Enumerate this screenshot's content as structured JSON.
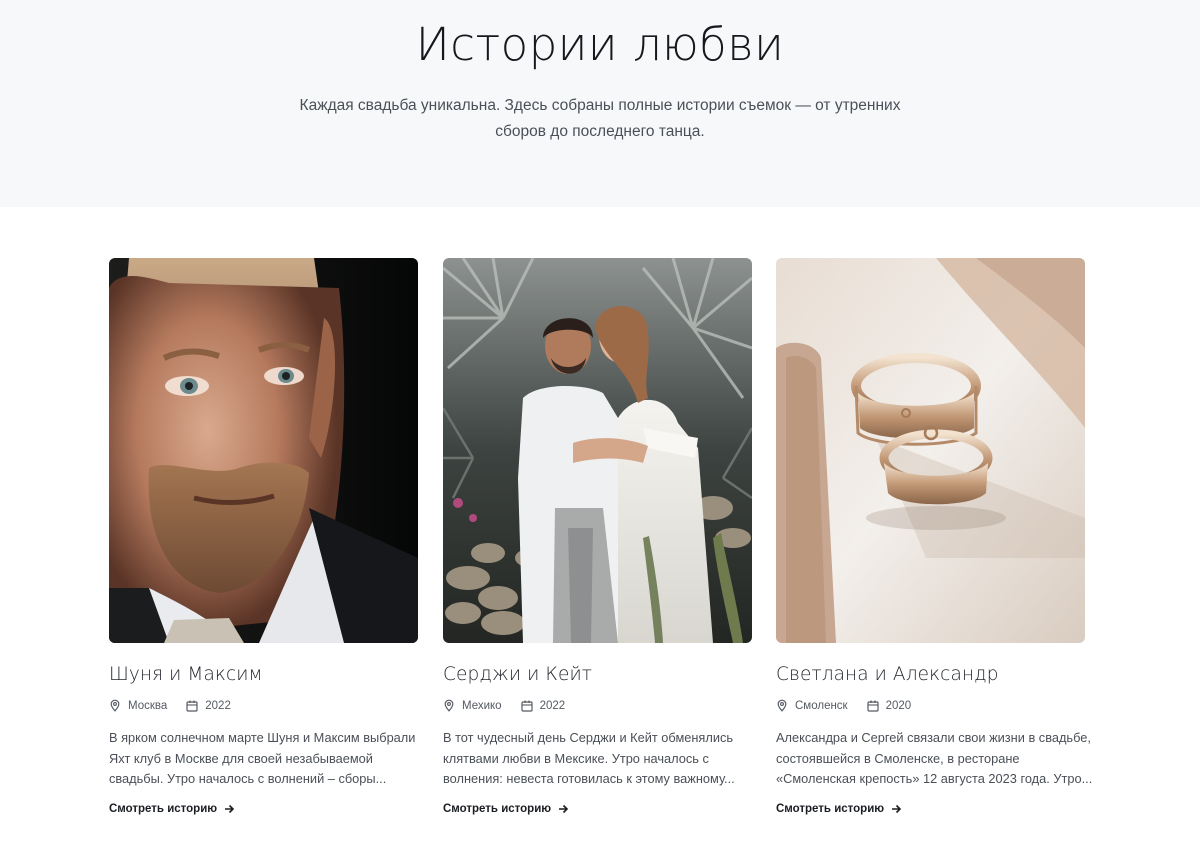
{
  "hero": {
    "title": "Истории любви",
    "subtitle": "Каждая свадьба уникальна. Здесь собраны полные истории съемок — от утренних сборов до последнего танца."
  },
  "stories": [
    {
      "title": "Шуня и Максим",
      "location": "Москва",
      "year": "2022",
      "description": "В ярком солнечном марте Шуня и Максим выбрали Яхт клуб в Москве для своей незабываемой свадьбы. Утро началось с волнений – сборы...",
      "link_label": "Смотреть историю",
      "photo": "groom-portrait"
    },
    {
      "title": "Серджи и Кейт",
      "location": "Мехико",
      "year": "2022",
      "description": "В тот чудесный день Серджи и Кейт обменялись клятвами любви в Мексике. Утро началось с волнения: невеста готовилась к этому важному...",
      "link_label": "Смотреть историю",
      "photo": "couple-embrace"
    },
    {
      "title": "Светлана и Александр",
      "location": "Смоленск",
      "year": "2020",
      "description": "Александра и Сергей связали свои жизни в свадьбе, состоявшейся в Смоленске, в ресторане «Смоленская крепость» 12 августа 2023 года. Утро...",
      "link_label": "Смотреть историю",
      "photo": "wedding-rings"
    }
  ],
  "icons": {
    "location": "map-pin-icon",
    "date": "calendar-icon",
    "link": "arrow-right-icon"
  },
  "colors": {
    "hero_background": "#f7f8fa",
    "text_dark": "#1f2329",
    "text_muted": "#4a4f57"
  }
}
